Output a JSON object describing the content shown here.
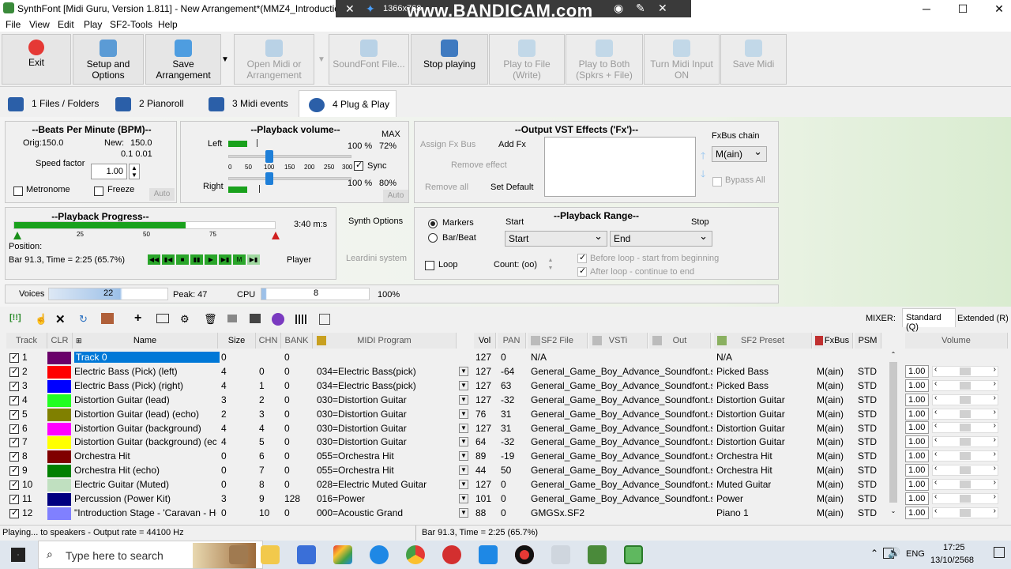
{
  "window": {
    "title": "SynthFont [Midi Guru, Version 1.811] - New Arrangement*(MMZ4_Introduction_",
    "minimize": "─",
    "maximize": "☐",
    "close": "✕"
  },
  "recorder": {
    "resolution": "1366x768",
    "watermark": "www.BANDICAM.com"
  },
  "menu": [
    "File",
    "View",
    "Edit",
    "Play",
    "SF2-Tools",
    "Help"
  ],
  "toolbar": {
    "exit": "Exit",
    "setup": [
      "Setup and",
      "Options"
    ],
    "save": "Save Arrangement",
    "open": [
      "Open Midi or",
      "Arrangement"
    ],
    "soundfont": "SoundFont File...",
    "stop": "Stop playing",
    "play_file": [
      "Play to File",
      "(Write)"
    ],
    "play_both": [
      "Play to Both",
      "(Spkrs + File)"
    ],
    "midi_input": [
      "Turn Midi Input",
      "ON"
    ],
    "save_midi": "Save Midi"
  },
  "tabs": [
    "1 Files / Folders",
    "2 Pianoroll",
    "3 Midi events",
    "4 Plug & Play"
  ],
  "bpm": {
    "title": "--Beats Per Minute (BPM)--",
    "orig": "Orig:150.0",
    "new_label": "New:",
    "new_value": "150.0",
    "steps": "0.1  0.01",
    "speed_label": "Speed factor",
    "speed_value": "1.00",
    "metronome": "Metronome",
    "freeze": "Freeze",
    "auto": "Auto"
  },
  "volume": {
    "title": "--Playback volume--",
    "max": "MAX",
    "left": "Left",
    "right": "Right",
    "left_pct": "100 %",
    "left_max": "72%",
    "right_pct": "100 %",
    "right_max": "80%",
    "ticks": [
      "0",
      "50",
      "100",
      "150",
      "200",
      "250",
      "300"
    ],
    "sync": "Sync",
    "auto": "Auto",
    "level": 1.0
  },
  "vst": {
    "title": "--Output VST Effects ('Fx')--",
    "assign": "Assign Fx Bus",
    "add": "Add Fx",
    "remove": "Remove effect",
    "remove_all": "Remove all",
    "set_default": "Set Default",
    "chain_label": "FxBus chain",
    "chain_value": "M(ain)",
    "bypass": "Bypass All"
  },
  "progress": {
    "title": "--Playback Progress--",
    "time": "3:40 m:s",
    "ticks": [
      "25",
      "50",
      "75"
    ],
    "position_label": "Position:",
    "position": "Bar 91.3, Time = 2:25 (65.7%)",
    "player": "Player",
    "fraction": 0.657
  },
  "synth": {
    "options": "Synth Options",
    "leardini": "Leardini system"
  },
  "range": {
    "title": "--Playback Range--",
    "markers": "Markers",
    "barbeat": "Bar/Beat",
    "start_label": "Start",
    "stop_label": "Stop",
    "start_value": "Start",
    "stop_value": "End",
    "loop": "Loop",
    "count": "Count: (oo)",
    "before_loop": "Before loop - start from beginning",
    "after_loop": "After loop - continue to end"
  },
  "meters": {
    "voices_label": "Voices",
    "voices": "22",
    "peak": "Peak:  47",
    "cpu_label": "CPU",
    "cpu": "8",
    "cpu_max": "100%"
  },
  "mixer": {
    "label": "MIXER:",
    "tab_standard": "Standard (Q)",
    "tab_extended": "Extended (R)",
    "volume": "Volume"
  },
  "columns": [
    "Track",
    "CLR",
    "Name",
    "Size",
    "CHN",
    "BANK",
    "MIDI Program",
    "Vol",
    "PAN",
    "SF2 File",
    "VSTi",
    "Out",
    "SF2 Preset",
    "FxBus",
    "PSM"
  ],
  "tracks": [
    {
      "num": "1",
      "color": "#6a006a",
      "name": "Track 0",
      "size": "0",
      "chn": "",
      "bank": "0",
      "program": "",
      "vol": "127",
      "pan": "0",
      "sf2": "N/A",
      "preset": "N/A",
      "fxbus": "",
      "psm": "",
      "selected": true
    },
    {
      "num": "2",
      "color": "#ff0000",
      "name": "Electric Bass (Pick) (left)",
      "size": "4",
      "chn": "0",
      "bank": "0",
      "program": "034=Electric Bass(pick)",
      "vol": "127",
      "pan": "-64",
      "sf2": "General_Game_Boy_Advance_Soundfont.sf2",
      "preset": "Picked Bass",
      "fxbus": "M(ain)",
      "psm": "STD"
    },
    {
      "num": "3",
      "color": "#0000ff",
      "name": "Electric Bass (Pick) (right)",
      "size": "4",
      "chn": "1",
      "bank": "0",
      "program": "034=Electric Bass(pick)",
      "vol": "127",
      "pan": "63",
      "sf2": "General_Game_Boy_Advance_Soundfont.sf2",
      "preset": "Picked Bass",
      "fxbus": "M(ain)",
      "psm": "STD"
    },
    {
      "num": "4",
      "color": "#22ff22",
      "name": "Distortion Guitar (lead)",
      "size": "3",
      "chn": "2",
      "bank": "0",
      "program": "030=Distortion Guitar",
      "vol": "127",
      "pan": "-32",
      "sf2": "General_Game_Boy_Advance_Soundfont.sf2",
      "preset": "Distortion Guitar",
      "fxbus": "M(ain)",
      "psm": "STD"
    },
    {
      "num": "5",
      "color": "#808000",
      "name": "Distortion Guitar (lead) (echo)",
      "size": "2",
      "chn": "3",
      "bank": "0",
      "program": "030=Distortion Guitar",
      "vol": "76",
      "pan": "31",
      "sf2": "General_Game_Boy_Advance_Soundfont.sf2",
      "preset": "Distortion Guitar",
      "fxbus": "M(ain)",
      "psm": "STD"
    },
    {
      "num": "6",
      "color": "#ff00ff",
      "name": "Distortion Guitar (background)",
      "size": "4",
      "chn": "4",
      "bank": "0",
      "program": "030=Distortion Guitar",
      "vol": "127",
      "pan": "31",
      "sf2": "General_Game_Boy_Advance_Soundfont.sf2",
      "preset": "Distortion Guitar",
      "fxbus": "M(ain)",
      "psm": "STD"
    },
    {
      "num": "7",
      "color": "#ffff00",
      "name": "Distortion Guitar (background) (ech",
      "size": "4",
      "chn": "5",
      "bank": "0",
      "program": "030=Distortion Guitar",
      "vol": "64",
      "pan": "-32",
      "sf2": "General_Game_Boy_Advance_Soundfont.sf2",
      "preset": "Distortion Guitar",
      "fxbus": "M(ain)",
      "psm": "STD"
    },
    {
      "num": "8",
      "color": "#800000",
      "name": "Orchestra Hit",
      "size": "0",
      "chn": "6",
      "bank": "0",
      "program": "055=Orchestra Hit",
      "vol": "89",
      "pan": "-19",
      "sf2": "General_Game_Boy_Advance_Soundfont.sf2",
      "preset": "Orchestra Hit",
      "fxbus": "M(ain)",
      "psm": "STD"
    },
    {
      "num": "9",
      "color": "#008000",
      "name": "Orchestra Hit (echo)",
      "size": "0",
      "chn": "7",
      "bank": "0",
      "program": "055=Orchestra Hit",
      "vol": "44",
      "pan": "50",
      "sf2": "General_Game_Boy_Advance_Soundfont.sf2",
      "preset": "Orchestra Hit",
      "fxbus": "M(ain)",
      "psm": "STD"
    },
    {
      "num": "10",
      "color": "#c0e0c0",
      "name": "Electric Guitar (Muted)",
      "size": "0",
      "chn": "8",
      "bank": "0",
      "program": "028=Electric Muted Guitar",
      "vol": "127",
      "pan": "0",
      "sf2": "General_Game_Boy_Advance_Soundfont.sf2",
      "preset": "Muted Guitar",
      "fxbus": "M(ain)",
      "psm": "STD"
    },
    {
      "num": "11",
      "color": "#000080",
      "name": "Percussion (Power Kit)",
      "size": "3",
      "chn": "9",
      "bank": "128",
      "program": "016=Power",
      "vol": "101",
      "pan": "0",
      "sf2": "General_Game_Boy_Advance_Soundfont.sf2",
      "preset": "Power",
      "fxbus": "M(ain)",
      "psm": "STD"
    },
    {
      "num": "12",
      "color": "#8080ff",
      "name": "\"Introduction Stage - 'Caravan - Ho",
      "size": "0",
      "chn": "10",
      "bank": "0",
      "program": "000=Acoustic Grand",
      "vol": "88",
      "pan": "0",
      "sf2": "GMGSx.SF2",
      "preset": "Piano 1",
      "fxbus": "M(ain)",
      "psm": "STD"
    }
  ],
  "mixer_values": [
    "1.00",
    "1.00",
    "1.00",
    "1.00",
    "1.00",
    "1.00",
    "1.00",
    "1.00",
    "1.00",
    "1.00",
    "1.00"
  ],
  "status": {
    "left": "Playing... to speakers - Output rate = 44100 Hz",
    "right": "Bar 91.3, Time = 2:25 (65.7%)"
  },
  "taskbar": {
    "search": "Type here to search",
    "lang": "ENG",
    "time": "17:25",
    "date": "13/10/2568"
  }
}
